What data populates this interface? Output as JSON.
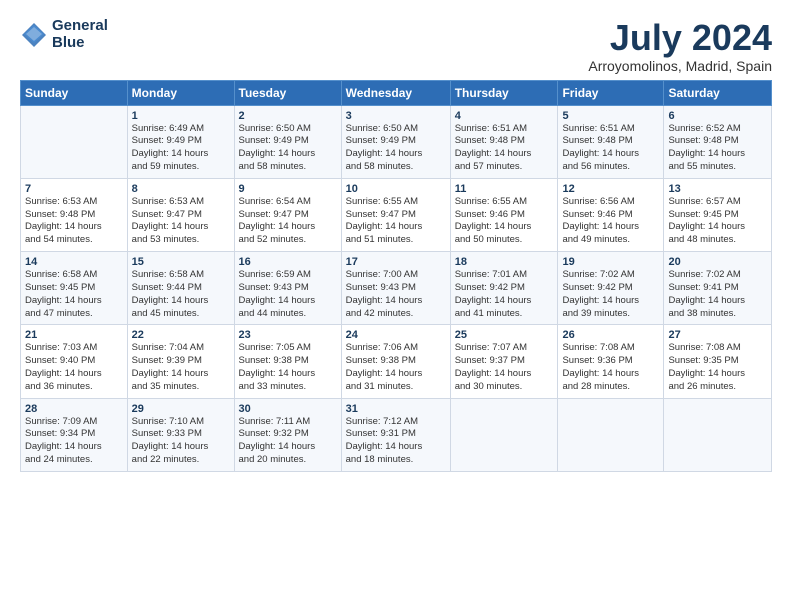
{
  "header": {
    "logo_line1": "General",
    "logo_line2": "Blue",
    "title": "July 2024",
    "subtitle": "Arroyomolinos, Madrid, Spain"
  },
  "columns": [
    "Sunday",
    "Monday",
    "Tuesday",
    "Wednesday",
    "Thursday",
    "Friday",
    "Saturday"
  ],
  "weeks": [
    [
      {
        "day": "",
        "info": ""
      },
      {
        "day": "1",
        "info": "Sunrise: 6:49 AM\nSunset: 9:49 PM\nDaylight: 14 hours\nand 59 minutes."
      },
      {
        "day": "2",
        "info": "Sunrise: 6:50 AM\nSunset: 9:49 PM\nDaylight: 14 hours\nand 58 minutes."
      },
      {
        "day": "3",
        "info": "Sunrise: 6:50 AM\nSunset: 9:49 PM\nDaylight: 14 hours\nand 58 minutes."
      },
      {
        "day": "4",
        "info": "Sunrise: 6:51 AM\nSunset: 9:48 PM\nDaylight: 14 hours\nand 57 minutes."
      },
      {
        "day": "5",
        "info": "Sunrise: 6:51 AM\nSunset: 9:48 PM\nDaylight: 14 hours\nand 56 minutes."
      },
      {
        "day": "6",
        "info": "Sunrise: 6:52 AM\nSunset: 9:48 PM\nDaylight: 14 hours\nand 55 minutes."
      }
    ],
    [
      {
        "day": "7",
        "info": "Sunrise: 6:53 AM\nSunset: 9:48 PM\nDaylight: 14 hours\nand 54 minutes."
      },
      {
        "day": "8",
        "info": "Sunrise: 6:53 AM\nSunset: 9:47 PM\nDaylight: 14 hours\nand 53 minutes."
      },
      {
        "day": "9",
        "info": "Sunrise: 6:54 AM\nSunset: 9:47 PM\nDaylight: 14 hours\nand 52 minutes."
      },
      {
        "day": "10",
        "info": "Sunrise: 6:55 AM\nSunset: 9:47 PM\nDaylight: 14 hours\nand 51 minutes."
      },
      {
        "day": "11",
        "info": "Sunrise: 6:55 AM\nSunset: 9:46 PM\nDaylight: 14 hours\nand 50 minutes."
      },
      {
        "day": "12",
        "info": "Sunrise: 6:56 AM\nSunset: 9:46 PM\nDaylight: 14 hours\nand 49 minutes."
      },
      {
        "day": "13",
        "info": "Sunrise: 6:57 AM\nSunset: 9:45 PM\nDaylight: 14 hours\nand 48 minutes."
      }
    ],
    [
      {
        "day": "14",
        "info": "Sunrise: 6:58 AM\nSunset: 9:45 PM\nDaylight: 14 hours\nand 47 minutes."
      },
      {
        "day": "15",
        "info": "Sunrise: 6:58 AM\nSunset: 9:44 PM\nDaylight: 14 hours\nand 45 minutes."
      },
      {
        "day": "16",
        "info": "Sunrise: 6:59 AM\nSunset: 9:43 PM\nDaylight: 14 hours\nand 44 minutes."
      },
      {
        "day": "17",
        "info": "Sunrise: 7:00 AM\nSunset: 9:43 PM\nDaylight: 14 hours\nand 42 minutes."
      },
      {
        "day": "18",
        "info": "Sunrise: 7:01 AM\nSunset: 9:42 PM\nDaylight: 14 hours\nand 41 minutes."
      },
      {
        "day": "19",
        "info": "Sunrise: 7:02 AM\nSunset: 9:42 PM\nDaylight: 14 hours\nand 39 minutes."
      },
      {
        "day": "20",
        "info": "Sunrise: 7:02 AM\nSunset: 9:41 PM\nDaylight: 14 hours\nand 38 minutes."
      }
    ],
    [
      {
        "day": "21",
        "info": "Sunrise: 7:03 AM\nSunset: 9:40 PM\nDaylight: 14 hours\nand 36 minutes."
      },
      {
        "day": "22",
        "info": "Sunrise: 7:04 AM\nSunset: 9:39 PM\nDaylight: 14 hours\nand 35 minutes."
      },
      {
        "day": "23",
        "info": "Sunrise: 7:05 AM\nSunset: 9:38 PM\nDaylight: 14 hours\nand 33 minutes."
      },
      {
        "day": "24",
        "info": "Sunrise: 7:06 AM\nSunset: 9:38 PM\nDaylight: 14 hours\nand 31 minutes."
      },
      {
        "day": "25",
        "info": "Sunrise: 7:07 AM\nSunset: 9:37 PM\nDaylight: 14 hours\nand 30 minutes."
      },
      {
        "day": "26",
        "info": "Sunrise: 7:08 AM\nSunset: 9:36 PM\nDaylight: 14 hours\nand 28 minutes."
      },
      {
        "day": "27",
        "info": "Sunrise: 7:08 AM\nSunset: 9:35 PM\nDaylight: 14 hours\nand 26 minutes."
      }
    ],
    [
      {
        "day": "28",
        "info": "Sunrise: 7:09 AM\nSunset: 9:34 PM\nDaylight: 14 hours\nand 24 minutes."
      },
      {
        "day": "29",
        "info": "Sunrise: 7:10 AM\nSunset: 9:33 PM\nDaylight: 14 hours\nand 22 minutes."
      },
      {
        "day": "30",
        "info": "Sunrise: 7:11 AM\nSunset: 9:32 PM\nDaylight: 14 hours\nand 20 minutes."
      },
      {
        "day": "31",
        "info": "Sunrise: 7:12 AM\nSunset: 9:31 PM\nDaylight: 14 hours\nand 18 minutes."
      },
      {
        "day": "",
        "info": ""
      },
      {
        "day": "",
        "info": ""
      },
      {
        "day": "",
        "info": ""
      }
    ]
  ]
}
